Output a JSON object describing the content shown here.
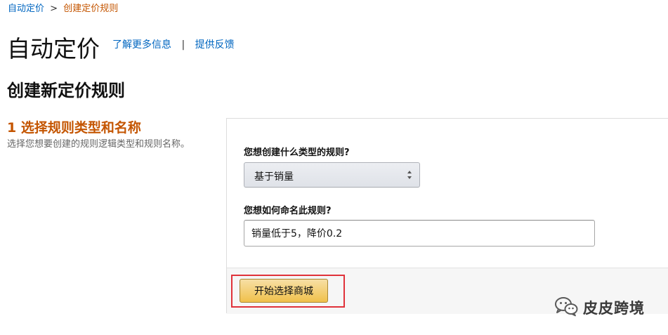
{
  "breadcrumb": {
    "root": "自动定价",
    "separator": ">",
    "current": "创建定价规则"
  },
  "header": {
    "title": "自动定价",
    "learn_more": "了解更多信息",
    "divider": "|",
    "feedback": "提供反馈"
  },
  "section": {
    "title": "创建新定价规则"
  },
  "step": {
    "title": "1 选择规则类型和名称",
    "description": "选择您想要创建的规则逻辑类型和规则名称。"
  },
  "form": {
    "rule_type_label": "您想创建什么类型的规则?",
    "rule_type_value": "基于销量",
    "rule_name_label": "您想如何命名此规则?",
    "rule_name_value": "销量低于5，降价0.2",
    "start_button": "开始选择商城"
  },
  "watermark": {
    "icon": "wechat-icon",
    "text": "皮皮跨境"
  },
  "colors": {
    "link": "#0066c0",
    "accent_orange": "#c45500",
    "button_yellow": "#f0c14b",
    "highlight_red": "#e0323a"
  }
}
